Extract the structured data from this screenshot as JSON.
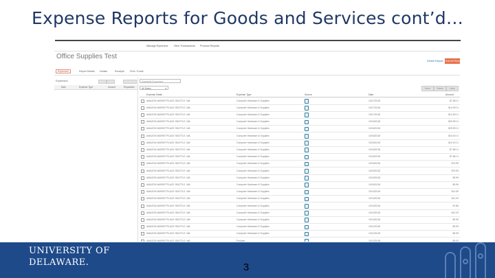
{
  "slide": {
    "title": "Expense Reports for Goods and Services cont’d…",
    "page_number": "3"
  },
  "app": {
    "top_tabs": [
      "Manage Expenses",
      "View Transactions",
      "Process Reports"
    ],
    "report_title": "Office Supplies Test",
    "header_links": [
      "Delete Report"
    ],
    "submit_button": "Submit Report",
    "sub_tabs": [
      "Expenses",
      "Report Details",
      "Details",
      "Receipts",
      "Print / Email"
    ],
    "left_panel": {
      "label": "Expenses",
      "columns": [
        "Date",
        "Expense Type",
        "Amount",
        "Requested"
      ]
    },
    "search_placeholder": "Available Expenses",
    "filter_value": "All Dates",
    "action_buttons": [
      "Move",
      "Delete",
      "Undo"
    ],
    "grid_columns": [
      "Expense Detail",
      "Expense Type",
      "Source",
      "Date",
      "Amount"
    ],
    "rows": [
      {
        "detail": "AMAZON MARKETPLACE SEATTLE, WA",
        "type": "Computer Hardware & Supplies",
        "date": "10/17/2018",
        "amount": "$7.86 Cr"
      },
      {
        "detail": "AMAZON MARKETPLACE SEATTLE, WA",
        "type": "Computer Hardware & Supplies",
        "date": "10/17/2018",
        "amount": "$14.99 Cr"
      },
      {
        "detail": "AMAZON MARKETPLACE SEATTLE, WA",
        "type": "Computer Hardware & Supplies",
        "date": "10/17/2018",
        "amount": "$14.99 Cr"
      },
      {
        "detail": "AMAZON MARKETPLACE SEATTLE, WA",
        "type": "Computer Hardware & Supplies",
        "date": "10/16/2018",
        "amount": "$29.99 Cr"
      },
      {
        "detail": "AMAZON MARKETPLACE SEATTLE, WA",
        "type": "Computer Hardware & Supplies",
        "date": "10/16/2018",
        "amount": "$29.99 Cr"
      },
      {
        "detail": "AMAZON MARKETPLACE SEATTLE, WA",
        "type": "Computer Hardware & Supplies",
        "date": "10/16/2018",
        "amount": "$34.00 Cr"
      },
      {
        "detail": "AMAZON MARKETPLACE SEATTLE, WA",
        "type": "Computer Hardware & Supplies",
        "date": "10/15/2018",
        "amount": "$12.00 Cr"
      },
      {
        "detail": "AMAZON MARKETPLACE SEATTLE, WA",
        "type": "Computer Hardware & Supplies",
        "date": "10/15/2018",
        "amount": "$7.86 Cr"
      },
      {
        "detail": "AMAZON MARKETPLACE SEATTLE, WA",
        "type": "Computer Hardware & Supplies",
        "date": "10/15/2018",
        "amount": "$7.86 Cr"
      },
      {
        "detail": "AMAZON MARKETPLACE SEATTLE, WA",
        "type": "Computer Hardware & Supplies",
        "date": "10/15/2018",
        "amount": "$79.99"
      },
      {
        "detail": "AMAZON MARKETPLACE SEATTLE, WA",
        "type": "Computer Hardware & Supplies",
        "date": "10/15/2018",
        "amount": "$79.99"
      },
      {
        "detail": "AMAZON MARKETPLACE SEATTLE, WA",
        "type": "Computer Hardware & Supplies",
        "date": "10/15/2018",
        "amount": "$9.99"
      },
      {
        "detail": "AMAZON MARKETPLACE SEATTLE, WA",
        "type": "Computer Hardware & Supplies",
        "date": "10/15/2018",
        "amount": "$9.99"
      },
      {
        "detail": "AMAZON MARKETPLACE SEATTLE, WA",
        "type": "Computer Hardware & Supplies",
        "date": "10/13/2018",
        "amount": "$14.99"
      },
      {
        "detail": "AMAZON MARKETPLACE SEATTLE, WA",
        "type": "Computer Hardware & Supplies",
        "date": "10/13/2018",
        "amount": "$11.00"
      },
      {
        "detail": "AMAZON MARKETPLACE SEATTLE, WA",
        "type": "Computer Hardware & Supplies",
        "date": "10/13/2018",
        "amount": "$7.86"
      },
      {
        "detail": "AMAZON MARKETPLACE SEATTLE, WA",
        "type": "Computer Hardware & Supplies",
        "date": "10/13/2018",
        "amount": "$12.00"
      },
      {
        "detail": "AMAZON MARKETPLACE SEATTLE, WA",
        "type": "Computer Hardware & Supplies",
        "date": "10/13/2018",
        "amount": "$9.99"
      },
      {
        "detail": "AMAZON MARKETPLACE SEATTLE, WA",
        "type": "Computer Hardware & Supplies",
        "date": "10/12/2018",
        "amount": "$9.99"
      },
      {
        "detail": "AMAZON MARKETPLACE SEATTLE, WA",
        "type": "Computer Hardware & Supplies",
        "date": "10/12/2018",
        "amount": "$5.99"
      },
      {
        "detail": "AMAZON MARKETPLACE SEATTLE, WA",
        "type": "Postage",
        "date": "10/12/2018",
        "amount": "$5.00"
      }
    ]
  },
  "footer": {
    "logo_line1": "UNIVERSITY OF",
    "logo_line2": "DELAWARE.",
    "background": "#1e4a8a"
  }
}
